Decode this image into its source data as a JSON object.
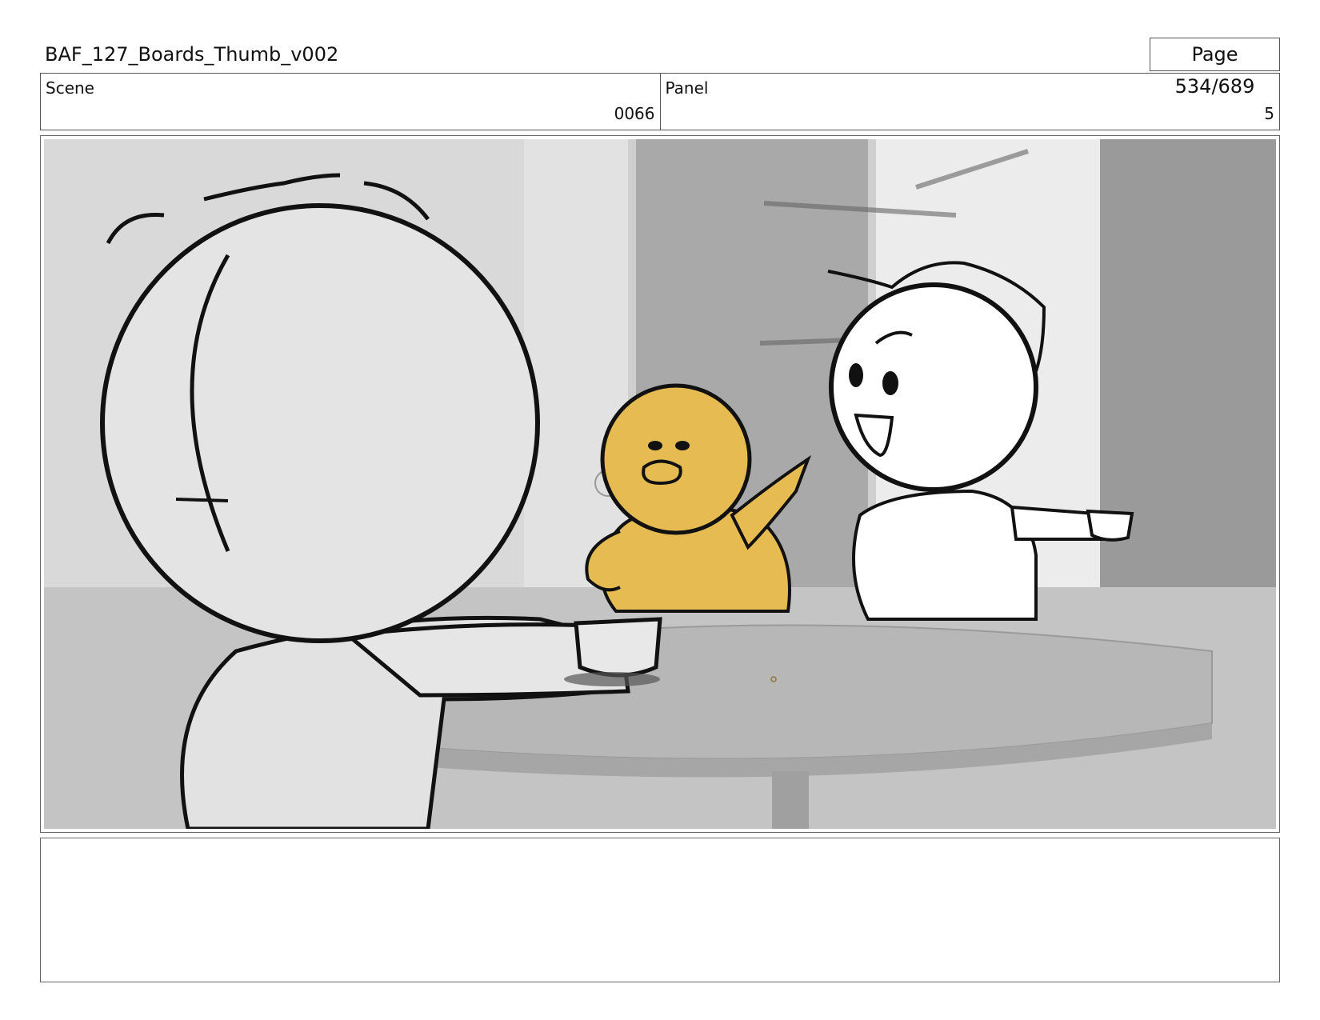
{
  "document": {
    "title": "BAF_127_Boards_Thumb_v002",
    "page": "Page 534/689"
  },
  "header": {
    "scene_label": "Scene",
    "scene_value": "0066",
    "panel_label": "Panel",
    "panel_value": "5"
  },
  "notes": {
    "text": ""
  },
  "colors": {
    "duck_yellow": "#e6bb51",
    "background_gray": "#c9c9c9",
    "line": "#111111"
  }
}
